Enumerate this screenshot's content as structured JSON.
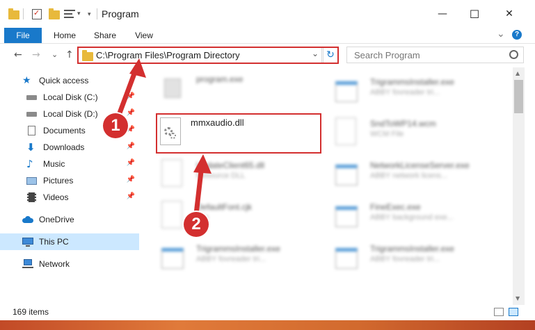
{
  "window": {
    "title": "Program",
    "minimize_glyph": "—",
    "maximize_glyph": "☐",
    "close_glyph": "✕"
  },
  "ribbon": {
    "tabs": [
      "File",
      "Home",
      "Share",
      "View"
    ],
    "collapse_glyph": "⌄",
    "help_glyph": "?"
  },
  "address_bar": {
    "path": "C:\\Program Files\\Program Directory",
    "dropdown_glyph": "⌄",
    "refresh_glyph": "↻"
  },
  "search": {
    "placeholder": "Search Program"
  },
  "navigation": {
    "back_glyph": "←",
    "forward_glyph": "→",
    "recent_glyph": "⌄",
    "up_glyph": "↑"
  },
  "sidebar": {
    "quick_access": "Quick access",
    "items": [
      {
        "label": "Local Disk (C:)",
        "icon": "drive-icon",
        "pinned": true
      },
      {
        "label": "Local Disk (D:)",
        "icon": "drive-icon",
        "pinned": true
      },
      {
        "label": "Documents",
        "icon": "documents-icon",
        "pinned": true
      },
      {
        "label": "Downloads",
        "icon": "downloads-icon",
        "pinned": true
      },
      {
        "label": "Music",
        "icon": "music-icon",
        "pinned": true
      },
      {
        "label": "Pictures",
        "icon": "pictures-icon",
        "pinned": true
      },
      {
        "label": "Videos",
        "icon": "videos-icon",
        "pinned": true
      }
    ],
    "onedrive": "OneDrive",
    "this_pc": "This PC",
    "network": "Network"
  },
  "files": {
    "left": [
      {
        "name": "program.exe",
        "sub": ""
      },
      {
        "name": "mmxaudio.dll",
        "sub": ""
      },
      {
        "name": "UpdateClient65.dll",
        "sub": "Resource DLL"
      },
      {
        "name": "DefaultFont.cjk",
        "sub": "File"
      },
      {
        "name": "TrigrammsInstaller.exe",
        "sub": "ABBY fovreader tri..."
      }
    ],
    "right": [
      {
        "name": "TrigrammsInstaller.exe",
        "sub": "ABBY fovreader tri..."
      },
      {
        "name": "SndToWP14.wcm",
        "sub": "WCM File"
      },
      {
        "name": "NetworkLicenseServer.exe",
        "sub": "ABBY network licens..."
      },
      {
        "name": "FineExec.exe",
        "sub": "ABBY background exe..."
      },
      {
        "name": "TrigrammsInstaller.exe",
        "sub": "ABBY fovreader tri..."
      }
    ]
  },
  "status": {
    "item_count": "169 items"
  },
  "callouts": {
    "one": "1",
    "two": "2"
  },
  "colors": {
    "accent": "#1979ca",
    "highlight_red": "#d32f2f",
    "selected_bg": "#cce8ff",
    "folder": "#e8b93c"
  }
}
